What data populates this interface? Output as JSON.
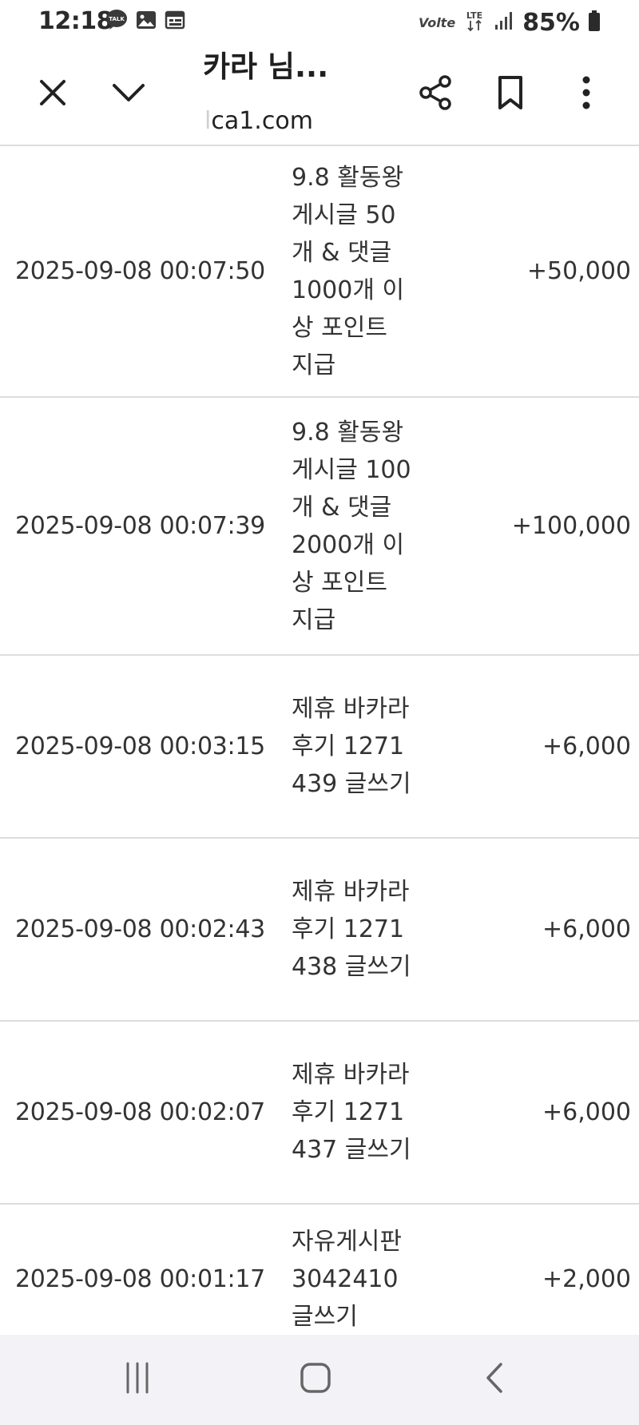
{
  "status_bar": {
    "time": "12:18",
    "notification_icons": [
      "kakaotalk-icon",
      "gallery-icon",
      "calendar-icon"
    ],
    "volte": "Volte",
    "network": "LTE",
    "battery": "85%"
  },
  "toolbar": {
    "title": "카라 님...",
    "url_fade": "l",
    "url": "ca1.com",
    "icons": [
      "close-icon",
      "chevron-down-icon",
      "share-icon",
      "bookmark-icon",
      "more-vert-icon"
    ]
  },
  "point_history": {
    "rows": [
      {
        "date": "2025-09-08 00:07:50",
        "desc": "9.8 활동왕 게시글 50개 & 댓글 1000개 이상 포인트 지급",
        "point": "+50,000"
      },
      {
        "date": "2025-09-08 00:07:39",
        "desc": "9.8 활동왕 게시글 100개 & 댓글 2000개 이상 포인트 지급",
        "point": "+100,000"
      },
      {
        "date": "2025-09-08 00:03:15",
        "desc": "제휴 바카라후기 1271439 글쓰기",
        "point": "+6,000"
      },
      {
        "date": "2025-09-08 00:02:43",
        "desc": "제휴 바카라후기 1271438 글쓰기",
        "point": "+6,000"
      },
      {
        "date": "2025-09-08 00:02:07",
        "desc": "제휴 바카라후기 1271437 글쓰기",
        "point": "+6,000"
      },
      {
        "date": "2025-09-08 00:01:17",
        "desc": "자유게시판 3042410 글쓰기",
        "point": "+2,000"
      }
    ]
  },
  "nav_bar": {
    "icons": [
      "recent-apps-icon",
      "home-icon",
      "back-icon"
    ]
  },
  "colors": {
    "text": "#333333",
    "divider": "#dddddd",
    "nav_bg": "#f3f2f7"
  }
}
